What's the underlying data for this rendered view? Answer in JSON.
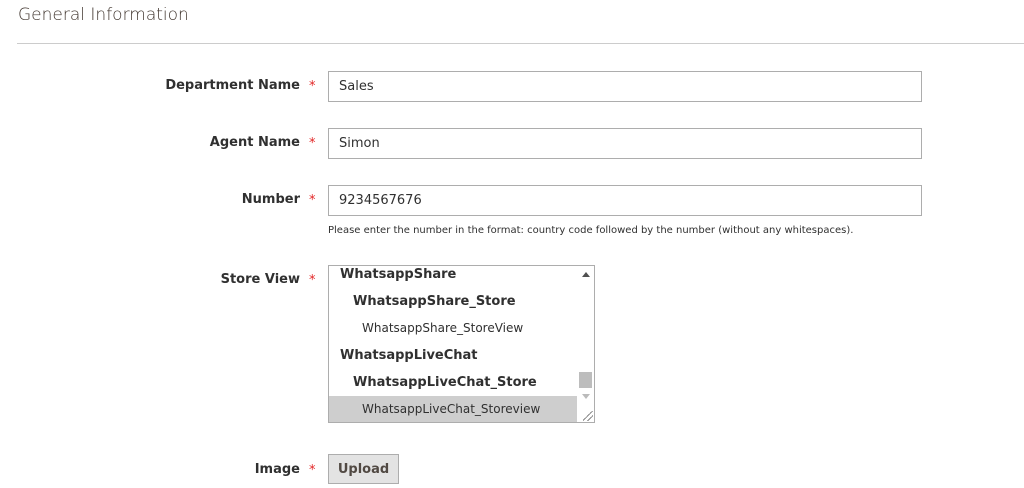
{
  "section_title": "General Information",
  "fields": {
    "department": {
      "label": "Department Name",
      "required": "*",
      "value": "Sales"
    },
    "agent": {
      "label": "Agent Name",
      "required": "*",
      "value": "Simon"
    },
    "number": {
      "label": "Number",
      "required": "*",
      "value": "9234567676",
      "note": "Please enter the number in the format: country code followed by the number (without any whitespaces)."
    },
    "store_view": {
      "label": "Store View",
      "required": "*",
      "options": [
        {
          "label": "WhatsappShare",
          "level": 0
        },
        {
          "label": "WhatsappShare_Store",
          "level": 1
        },
        {
          "label": "WhatsappShare_StoreView",
          "level": 2
        },
        {
          "label": "WhatsappLiveChat",
          "level": 0
        },
        {
          "label": "WhatsappLiveChat_Store",
          "level": 1
        },
        {
          "label": "WhatsappLiveChat_Storeview",
          "level": 2,
          "selected": true
        }
      ]
    },
    "image": {
      "label": "Image",
      "required": "*",
      "button": "Upload"
    }
  }
}
